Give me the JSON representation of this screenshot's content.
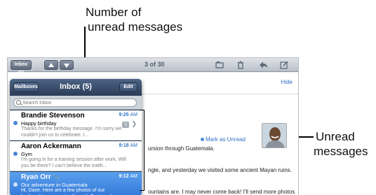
{
  "callouts": {
    "top_line1": "Number of",
    "top_line2": "unread messages",
    "right_line1": "Unread",
    "right_line2": "messages"
  },
  "toolbar": {
    "inbox_button": "Inbox (5)",
    "page_count": "3 of 30",
    "icons": [
      "up-arrow",
      "down-arrow",
      "folder",
      "trash",
      "reply",
      "compose"
    ]
  },
  "detail": {
    "hide": "Hide",
    "mark_unread": "Mark as Unread",
    "body_lines": [
      "ursion through Guatemala.",
      "ngle, and yesterday we visited some ancient Mayan ruins.",
      "ountains are. I may never come back! I'll send more photos"
    ]
  },
  "popover": {
    "mailboxes": "Mailboxes",
    "title": "Inbox (5)",
    "edit": "Edit",
    "search_placeholder": "Search Inbox",
    "messages": [
      {
        "sender": "Brandie Stevenson",
        "time": "9:25",
        "ampm": "AM",
        "subject": "Happy birthday",
        "preview": "Thanks for the birthday message. I'm sorry we couldn't join us to celebrate. I...",
        "thread_count": "3",
        "unread": true
      },
      {
        "sender": "Aaron Ackermann",
        "time": "9:18",
        "ampm": "AM",
        "subject": "Gym",
        "preview": "I'm going in for a training session after work. Will you be there? I can't believe the tratth...",
        "unread": true
      },
      {
        "sender": "Ryan Orr",
        "time": "9:12",
        "ampm": "AM",
        "subject": "Our adventure in Guatemala",
        "preview": "Hi, Dave. Here are a few photos of our backpacking excursion through Guatemal...",
        "unread": true,
        "selected": true
      }
    ]
  }
}
